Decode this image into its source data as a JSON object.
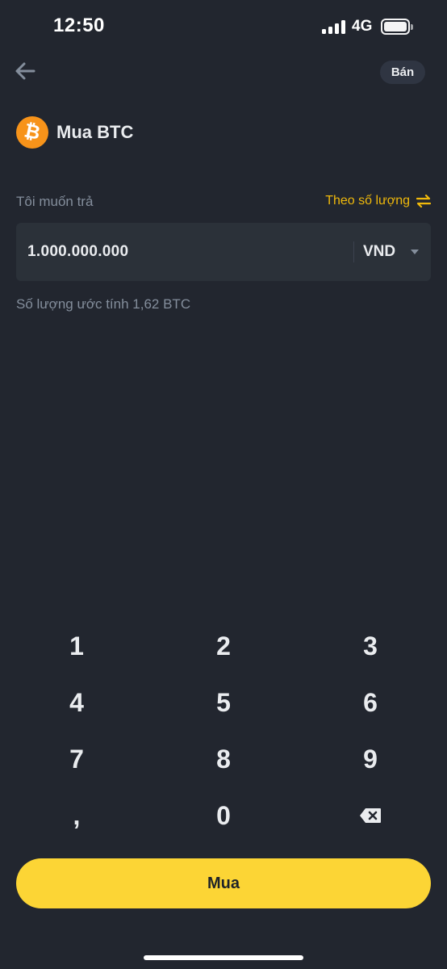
{
  "status_bar": {
    "time": "12:50",
    "network": "4G"
  },
  "header": {
    "back_icon": "arrow-left-icon",
    "sell_label": "Bán"
  },
  "title": {
    "coin_icon": "bitcoin-icon",
    "coin_symbol_glyph": "₿",
    "text": "Mua BTC",
    "icon_color": "#f7931a"
  },
  "form": {
    "pay_label": "Tôi muốn trả",
    "mode_toggle_label": "Theo số lượng",
    "mode_toggle_icon": "swap-arrows-icon",
    "amount": "1.000.000.000",
    "currency": "VND",
    "currency_dropdown_icon": "caret-down-icon",
    "estimate": "Số lượng ước tính 1,62 BTC"
  },
  "keypad": {
    "keys": [
      "1",
      "2",
      "3",
      "4",
      "5",
      "6",
      "7",
      "8",
      "9",
      ",",
      "0"
    ],
    "backspace_icon": "backspace-icon"
  },
  "actions": {
    "buy_label": "Mua"
  },
  "colors": {
    "background": "#22262f",
    "accent": "#f0b90b",
    "primary_button": "#fcd535",
    "input_background": "#2b3139",
    "muted_text": "#848e9c"
  }
}
